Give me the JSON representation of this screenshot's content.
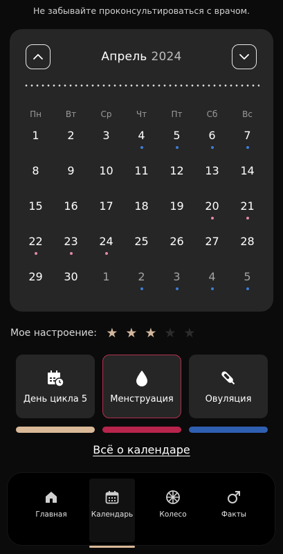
{
  "notice": "Не забывайте проконсультироваться с врачом.",
  "calendar": {
    "month": "Апрель",
    "year": "2024",
    "weekdays": [
      "Пн",
      "Вт",
      "Ср",
      "Чт",
      "Пт",
      "Сб",
      "Вс"
    ],
    "weeks": [
      [
        {
          "d": "1"
        },
        {
          "d": "2"
        },
        {
          "d": "3"
        },
        {
          "d": "4",
          "dot": "blue"
        },
        {
          "d": "5",
          "dot": "blue"
        },
        {
          "d": "6",
          "dot": "blue"
        },
        {
          "d": "7",
          "dot": "blue"
        }
      ],
      [
        {
          "d": "8"
        },
        {
          "d": "9"
        },
        {
          "d": "10"
        },
        {
          "d": "11"
        },
        {
          "d": "12"
        },
        {
          "d": "13"
        },
        {
          "d": "14"
        }
      ],
      [
        {
          "d": "15"
        },
        {
          "d": "16"
        },
        {
          "d": "17"
        },
        {
          "d": "18"
        },
        {
          "d": "19"
        },
        {
          "d": "20",
          "dot": "pink"
        },
        {
          "d": "21",
          "dot": "pink"
        }
      ],
      [
        {
          "d": "22",
          "dot": "pink"
        },
        {
          "d": "23",
          "dot": "pink"
        },
        {
          "d": "24",
          "dot": "pink"
        },
        {
          "d": "25"
        },
        {
          "d": "26"
        },
        {
          "d": "27"
        },
        {
          "d": "28"
        }
      ],
      [
        {
          "d": "29"
        },
        {
          "d": "30"
        },
        {
          "d": "1",
          "other": true
        },
        {
          "d": "2",
          "other": true,
          "dot": "blue"
        },
        {
          "d": "3",
          "other": true,
          "dot": "blue"
        },
        {
          "d": "4",
          "other": true,
          "dot": "blue"
        },
        {
          "d": "5",
          "other": true,
          "dot": "blue"
        }
      ]
    ]
  },
  "mood": {
    "label": "Мое настроение:",
    "rating": 3,
    "max": 5
  },
  "cards": [
    {
      "label": "День цикла 5",
      "icon": "calendar-clock-icon",
      "bar_color": "#d9b997"
    },
    {
      "label": "Менструация",
      "icon": "drop-icon",
      "bar_color": "#b7244c"
    },
    {
      "label": "Овуляция",
      "icon": "pipette-icon",
      "bar_color": "#2f5fb0"
    }
  ],
  "link": "Всё о календаре",
  "nav": [
    {
      "label": "Главная",
      "icon": "home-icon"
    },
    {
      "label": "Календарь",
      "icon": "calendar-icon",
      "active": true
    },
    {
      "label": "Колесо",
      "icon": "wheel-icon"
    },
    {
      "label": "Факты",
      "icon": "male-icon"
    }
  ],
  "colors": {
    "dot_blue": "#3f7fd6",
    "dot_pink": "#e58aa6",
    "star_on": "#d2b79d",
    "star_off": "#2c2c2c",
    "accent": "#d9b997"
  }
}
